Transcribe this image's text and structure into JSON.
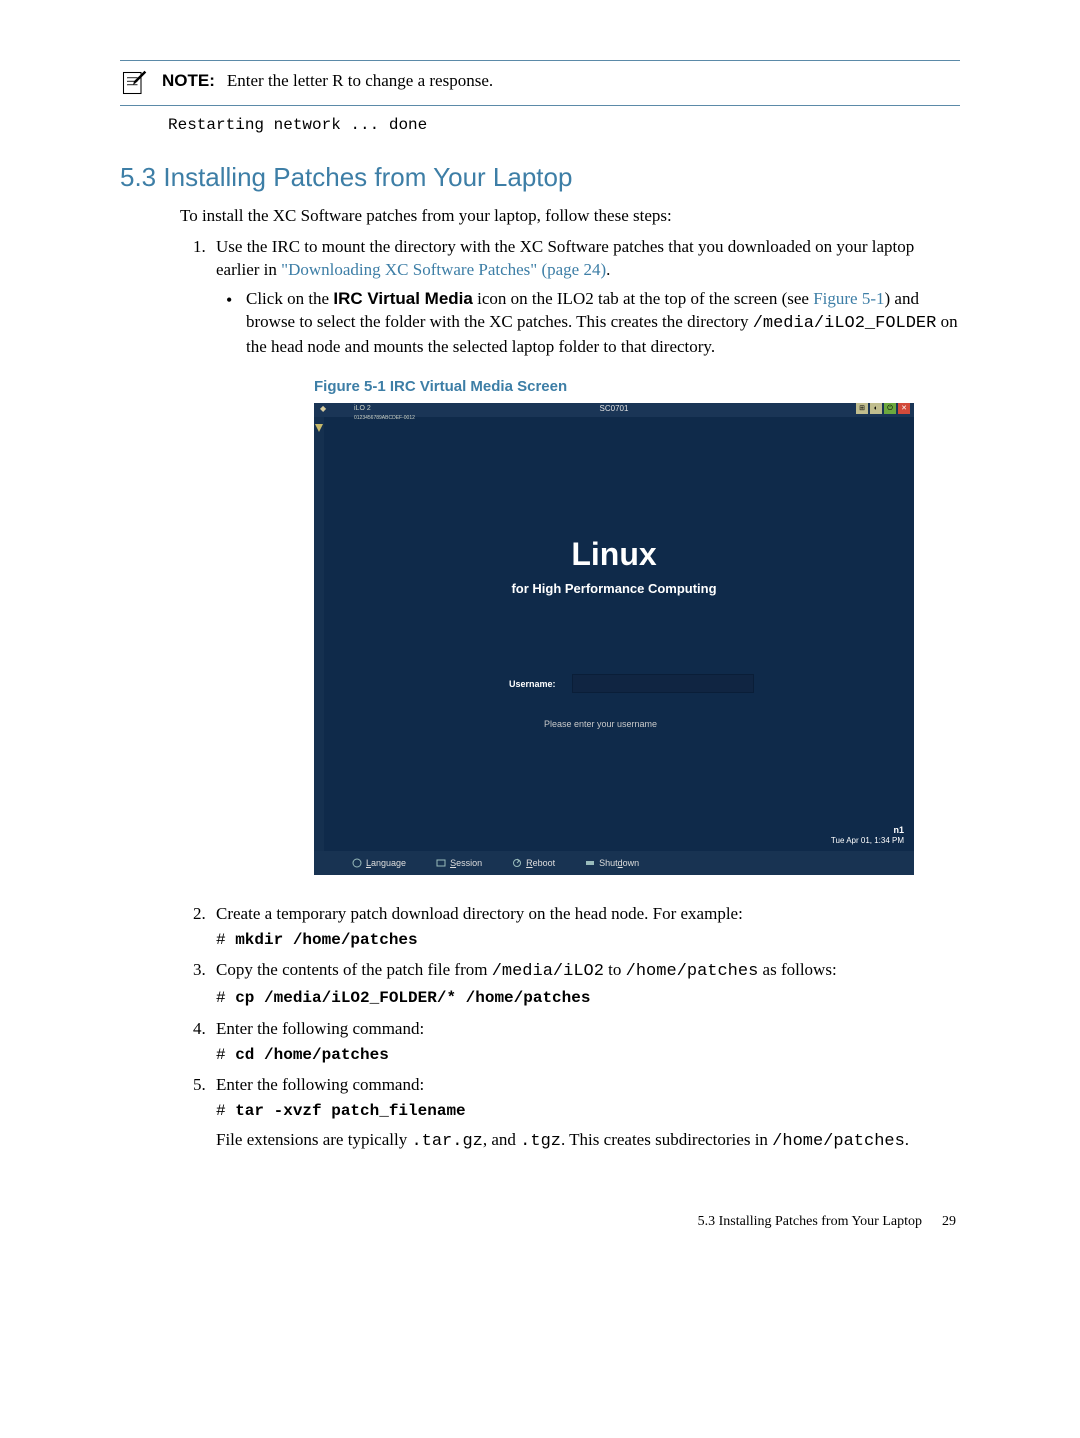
{
  "note": {
    "label": "NOTE:",
    "text": "Enter the letter R to change a response."
  },
  "code1": "Restarting network ... done",
  "section": {
    "number": "5.3",
    "title": "Installing Patches from Your Laptop"
  },
  "intro": "To install the XC Software patches from your laptop, follow these steps:",
  "step1": {
    "a": "Use the IRC to mount the directory with the XC Software patches that you downloaded on your laptop earlier in ",
    "link": "\"Downloading XC Software Patches\" (page 24)",
    "b": "."
  },
  "bullet": {
    "a": "Click on the ",
    "bold": "IRC Virtual Media",
    "b": " icon on the ILO2 tab at the top of the screen (see ",
    "figref": "Figure 5-1",
    "c": ") and browse to select the folder with the XC patches. This creates the directory ",
    "path": "/media/iLO2_FOLDER",
    "d": " on the head node and mounts the selected laptop folder to that directory."
  },
  "figure": {
    "caption": "Figure 5-1 IRC Virtual Media Screen",
    "topbar_ilo": "iLO 2",
    "topbar_sub": "0123456789ABCDEF-0012",
    "topbar_center": "SC0701",
    "linux": "Linux",
    "sub": "for High Performance Computing",
    "username_lbl": "Username:",
    "hint": "Please enter your username",
    "menu": {
      "lang": "Language",
      "sess": "Session",
      "reboot": "Reboot",
      "shutdown": "Shutdown"
    },
    "host": "n1",
    "time": "Tue Apr 01, 1:34 PM"
  },
  "step2": {
    "text": "Create a temporary patch download directory on the head node. For example:",
    "cmd_prefix": "# ",
    "cmd": "mkdir /home/patches"
  },
  "step3": {
    "a": "Copy the contents of the patch file from ",
    "p1": "/media/iLO2",
    "b": " to ",
    "p2": "/home/patches",
    "c": " as follows:",
    "cmd_prefix": "# ",
    "cmd": "cp /media/iLO2_FOLDER/* /home/patches"
  },
  "step4": {
    "text": "Enter the following command:",
    "cmd_prefix": "# ",
    "cmd": "cd /home/patches"
  },
  "step5": {
    "text": "Enter the following command:",
    "cmd_prefix": "# ",
    "cmd": "tar -xvzf patch_filename",
    "post_a": "File extensions are typically ",
    "ext1": ".tar.gz",
    "post_b": ", and ",
    "ext2": ".tgz",
    "post_c": ". This creates subdirectories in ",
    "p": "/home/patches",
    "post_d": "."
  },
  "footer": {
    "text": "5.3 Installing Patches from Your Laptop",
    "page": "29"
  }
}
